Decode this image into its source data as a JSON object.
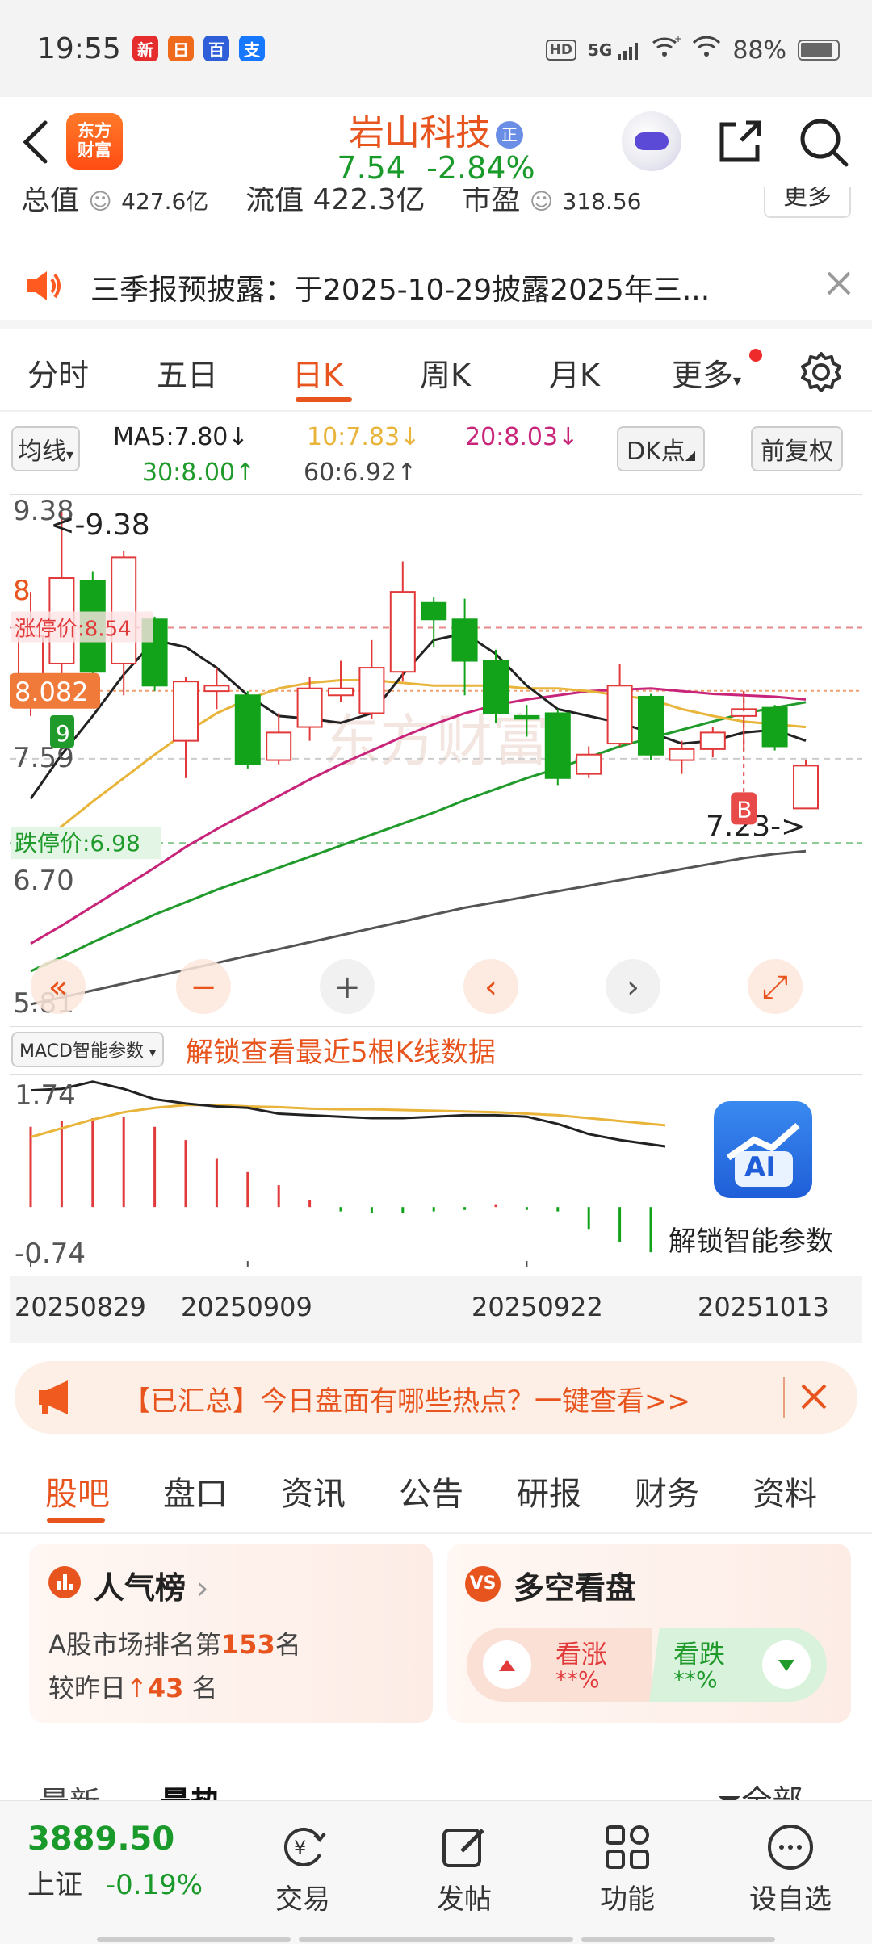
{
  "status_bar": {
    "time": "19:55",
    "hd_label": "HD",
    "network": "5G",
    "battery": "88%",
    "app_icons": [
      {
        "name": "news-app-icon",
        "glyph": "新",
        "color": "#e52d2d"
      },
      {
        "name": "calendar-app-icon",
        "glyph": "日",
        "color": "#f06a1c"
      },
      {
        "name": "baidu-app-icon",
        "glyph": "百",
        "color": "#2f5fd8"
      },
      {
        "name": "alipay-app-icon",
        "glyph": "支",
        "color": "#1677ff"
      }
    ]
  },
  "header": {
    "back_icon": "chevron-left-icon",
    "logo_line1": "东方",
    "logo_line2": "财富",
    "stock_name": "岩山科技",
    "badge": "正",
    "price": "7.54",
    "change_pct": "-2.84%"
  },
  "metrics": {
    "total_value_label": "总值",
    "total_value": "427.6亿",
    "float_value_label": "流值",
    "float_value": "422.3亿",
    "pe_label": "市盈",
    "pe_value": "318.56",
    "more_label": "更多"
  },
  "notice": {
    "text": "三季报预披露：于2025-10-29披露2025年三..."
  },
  "chart_tabs": [
    "分时",
    "五日",
    "日K",
    "周K",
    "月K",
    "更多"
  ],
  "active_chart_tab": "日K",
  "ma_row": {
    "selector": "均线",
    "ma5": "MA5:7.80↓",
    "ma10": "10:7.83↓",
    "ma20": "20:8.03↓",
    "ma30": "30:8.00↑",
    "ma60": "60:6.92↑",
    "dk_label": "DK点",
    "fq_label": "前复权"
  },
  "colors": {
    "brand": "#e8541e",
    "up": "#e23a3a",
    "down": "#13a31b",
    "ma5": "#222222",
    "ma10": "#e8b43a",
    "ma20": "#c8247a",
    "ma30": "#1f9a2b",
    "ma60": "#555555"
  },
  "chart_data": {
    "type": "candlestick",
    "y_ticks": [
      "9.38",
      "8",
      "7.59",
      "6.70",
      "5.81"
    ],
    "ylim": [
      5.81,
      9.38
    ],
    "high_label": "<-9.38",
    "low_label": "7.23->",
    "limit_up_label": "涨停价:8.54",
    "limit_up": 8.54,
    "limit_down_label": "跌停价:6.98",
    "limit_down": 6.98,
    "current_label": "8.082",
    "current": 8.082,
    "marker_9": "9",
    "marker_b": "B",
    "dates": [
      "20250829",
      "20250909",
      "20250922",
      "20251013"
    ],
    "candles": [
      {
        "o": 8.2,
        "c": 8.48,
        "h": 8.8,
        "l": 7.9
      },
      {
        "o": 8.28,
        "c": 8.9,
        "h": 9.38,
        "l": 8.1
      },
      {
        "o": 8.88,
        "c": 8.22,
        "h": 8.95,
        "l": 8.15
      },
      {
        "o": 8.28,
        "c": 9.05,
        "h": 9.1,
        "l": 8.05
      },
      {
        "o": 8.6,
        "c": 8.12,
        "h": 8.62,
        "l": 8.08
      },
      {
        "o": 7.72,
        "c": 8.15,
        "h": 8.18,
        "l": 7.45
      },
      {
        "o": 8.08,
        "c": 8.12,
        "h": 8.25,
        "l": 7.95
      },
      {
        "o": 8.05,
        "c": 7.55,
        "h": 8.08,
        "l": 7.52
      },
      {
        "o": 7.58,
        "c": 7.78,
        "h": 7.92,
        "l": 7.55
      },
      {
        "o": 7.82,
        "c": 8.1,
        "h": 8.18,
        "l": 7.72
      },
      {
        "o": 8.05,
        "c": 8.1,
        "h": 8.3,
        "l": 8.0
      },
      {
        "o": 7.92,
        "c": 8.25,
        "h": 8.45,
        "l": 7.88
      },
      {
        "o": 8.22,
        "c": 8.8,
        "h": 9.02,
        "l": 8.15
      },
      {
        "o": 8.72,
        "c": 8.6,
        "h": 8.76,
        "l": 8.4
      },
      {
        "o": 8.6,
        "c": 8.3,
        "h": 8.75,
        "l": 8.05
      },
      {
        "o": 8.3,
        "c": 7.92,
        "h": 8.38,
        "l": 7.85
      },
      {
        "o": 7.9,
        "c": 7.88,
        "h": 7.98,
        "l": 7.75
      },
      {
        "o": 7.92,
        "c": 7.45,
        "h": 7.95,
        "l": 7.4
      },
      {
        "o": 7.48,
        "c": 7.62,
        "h": 7.68,
        "l": 7.45
      },
      {
        "o": 7.7,
        "c": 8.12,
        "h": 8.28,
        "l": 7.68
      },
      {
        "o": 8.04,
        "c": 7.62,
        "h": 8.06,
        "l": 7.58
      },
      {
        "o": 7.58,
        "c": 7.66,
        "h": 7.72,
        "l": 7.48
      },
      {
        "o": 7.66,
        "c": 7.78,
        "h": 7.82,
        "l": 7.6
      },
      {
        "o": 7.9,
        "c": 7.95,
        "h": 8.08,
        "l": 7.65
      },
      {
        "o": 7.96,
        "c": 7.68,
        "h": 7.98,
        "l": 7.65
      },
      {
        "o": 7.23,
        "c": 7.54,
        "h": 7.58,
        "l": 7.23
      }
    ],
    "ma5": [
      7.3,
      7.62,
      7.9,
      8.2,
      8.45,
      8.4,
      8.25,
      8.05,
      7.9,
      7.88,
      7.85,
      7.92,
      8.2,
      8.45,
      8.5,
      8.35,
      8.12,
      7.95,
      7.9,
      7.85,
      7.78,
      7.7,
      7.72,
      7.78,
      7.8,
      7.72
    ],
    "ma10": [
      6.95,
      7.1,
      7.28,
      7.45,
      7.62,
      7.78,
      7.92,
      8.02,
      8.1,
      8.14,
      8.16,
      8.16,
      8.14,
      8.12,
      8.12,
      8.12,
      8.1,
      8.1,
      8.08,
      8.05,
      8.02,
      7.95,
      7.9,
      7.86,
      7.84,
      7.82
    ],
    "ma20": [
      6.25,
      6.38,
      6.52,
      6.66,
      6.8,
      6.95,
      7.08,
      7.2,
      7.32,
      7.44,
      7.55,
      7.65,
      7.75,
      7.84,
      7.92,
      7.98,
      8.02,
      8.05,
      8.08,
      8.09,
      8.1,
      8.08,
      8.06,
      8.05,
      8.04,
      8.02
    ],
    "ma30": [
      6.05,
      6.15,
      6.26,
      6.36,
      6.46,
      6.55,
      6.64,
      6.72,
      6.8,
      6.88,
      6.96,
      7.04,
      7.12,
      7.2,
      7.29,
      7.37,
      7.45,
      7.52,
      7.6,
      7.68,
      7.74,
      7.8,
      7.86,
      7.92,
      7.96,
      8.0
    ],
    "ma60": [
      5.81,
      5.86,
      5.91,
      5.96,
      6.01,
      6.06,
      6.11,
      6.16,
      6.21,
      6.26,
      6.31,
      6.36,
      6.41,
      6.46,
      6.51,
      6.55,
      6.59,
      6.63,
      6.67,
      6.71,
      6.75,
      6.79,
      6.83,
      6.87,
      6.9,
      6.92
    ],
    "macd": {
      "label": "MACD智能参数",
      "unlock_text": "解锁查看最近5根K线数据",
      "top_label": "1.74",
      "bottom_label": "-0.74",
      "ylim": [
        -0.74,
        1.74
      ],
      "bars": [
        1.1,
        1.18,
        1.22,
        1.24,
        1.1,
        0.92,
        0.66,
        0.48,
        0.3,
        0.1,
        -0.06,
        -0.08,
        -0.08,
        -0.06,
        -0.04,
        0.04,
        -0.04,
        -0.06,
        -0.3,
        -0.48,
        -0.62,
        -0.62,
        -0.55,
        -0.4,
        -0.3,
        -0.2
      ],
      "dif": [
        1.6,
        1.62,
        1.72,
        1.62,
        1.48,
        1.42,
        1.38,
        1.36,
        1.28,
        1.26,
        1.24,
        1.22,
        1.22,
        1.24,
        1.26,
        1.26,
        1.24,
        1.14,
        1.0,
        0.92,
        0.86,
        0.8,
        0.78,
        0.76,
        0.74,
        0.72
      ],
      "dea": [
        0.96,
        1.08,
        1.2,
        1.3,
        1.36,
        1.4,
        1.4,
        1.38,
        1.37,
        1.35,
        1.34,
        1.34,
        1.33,
        1.32,
        1.31,
        1.3,
        1.28,
        1.26,
        1.22,
        1.18,
        1.14,
        1.1,
        1.06,
        1.02,
        0.98,
        0.94
      ]
    }
  },
  "chart_controls": [
    "double-left-icon",
    "minus-icon",
    "plus-icon",
    "left-icon",
    "right-icon",
    "expand-icon"
  ],
  "ai_unlock_label": "解锁智能参数",
  "ai_badge": "AI",
  "promo": {
    "text": "【已汇总】今日盘面有哪些热点？一键查看>>"
  },
  "content_tabs": [
    "股吧",
    "盘口",
    "资讯",
    "公告",
    "研报",
    "财务",
    "资料"
  ],
  "active_content_tab": "股吧",
  "popularity": {
    "title": "人气榜",
    "rank_prefix": "A股市场排名第",
    "rank": "153",
    "rank_suffix": "名",
    "change_prefix": "较昨日",
    "change": "43",
    "change_suffix": " 名"
  },
  "longshort": {
    "title": "多空看盘",
    "up_label": "看涨",
    "up_value": "**%",
    "down_label": "看跌",
    "down_value": "**%"
  },
  "feed_filter": {
    "tab_latest": "最新",
    "tab_hot": "最热",
    "filter": "全部"
  },
  "bottom_nav": {
    "index_value": "3889.50",
    "index_name": "上证",
    "index_change": "-0.19%",
    "items": [
      "交易",
      "发帖",
      "功能",
      "设自选"
    ]
  }
}
